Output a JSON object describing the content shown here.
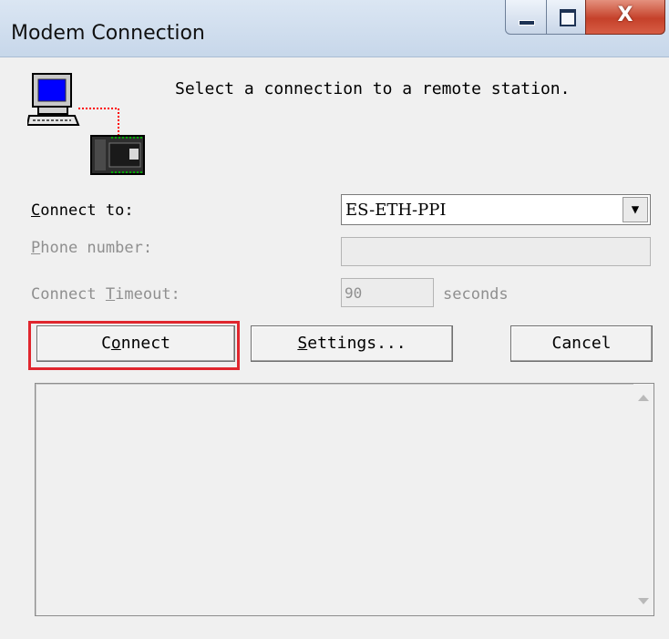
{
  "window": {
    "title": "Modem Connection",
    "close_glyph": "X"
  },
  "header": {
    "icon": "computer-plc-icon",
    "intro_text": "Select a connection to a remote station."
  },
  "form": {
    "connect_to": {
      "label_mnemonic": "C",
      "label_rest": "onnect to:",
      "value": "ES-ETH-PPI"
    },
    "phone_number": {
      "label_mnemonic": "P",
      "label_rest": "hone number:",
      "value": ""
    },
    "connect_timeout": {
      "label_before": "Connect ",
      "label_mnemonic": "T",
      "label_rest": "imeout:",
      "value": "90",
      "unit": "seconds"
    }
  },
  "buttons": {
    "connect": {
      "before": "C",
      "mnemonic": "o",
      "rest": "nnect"
    },
    "settings": {
      "mnemonic": "S",
      "rest": "ettings..."
    },
    "cancel": "Cancel"
  },
  "colors": {
    "highlight": "#e0262e"
  }
}
